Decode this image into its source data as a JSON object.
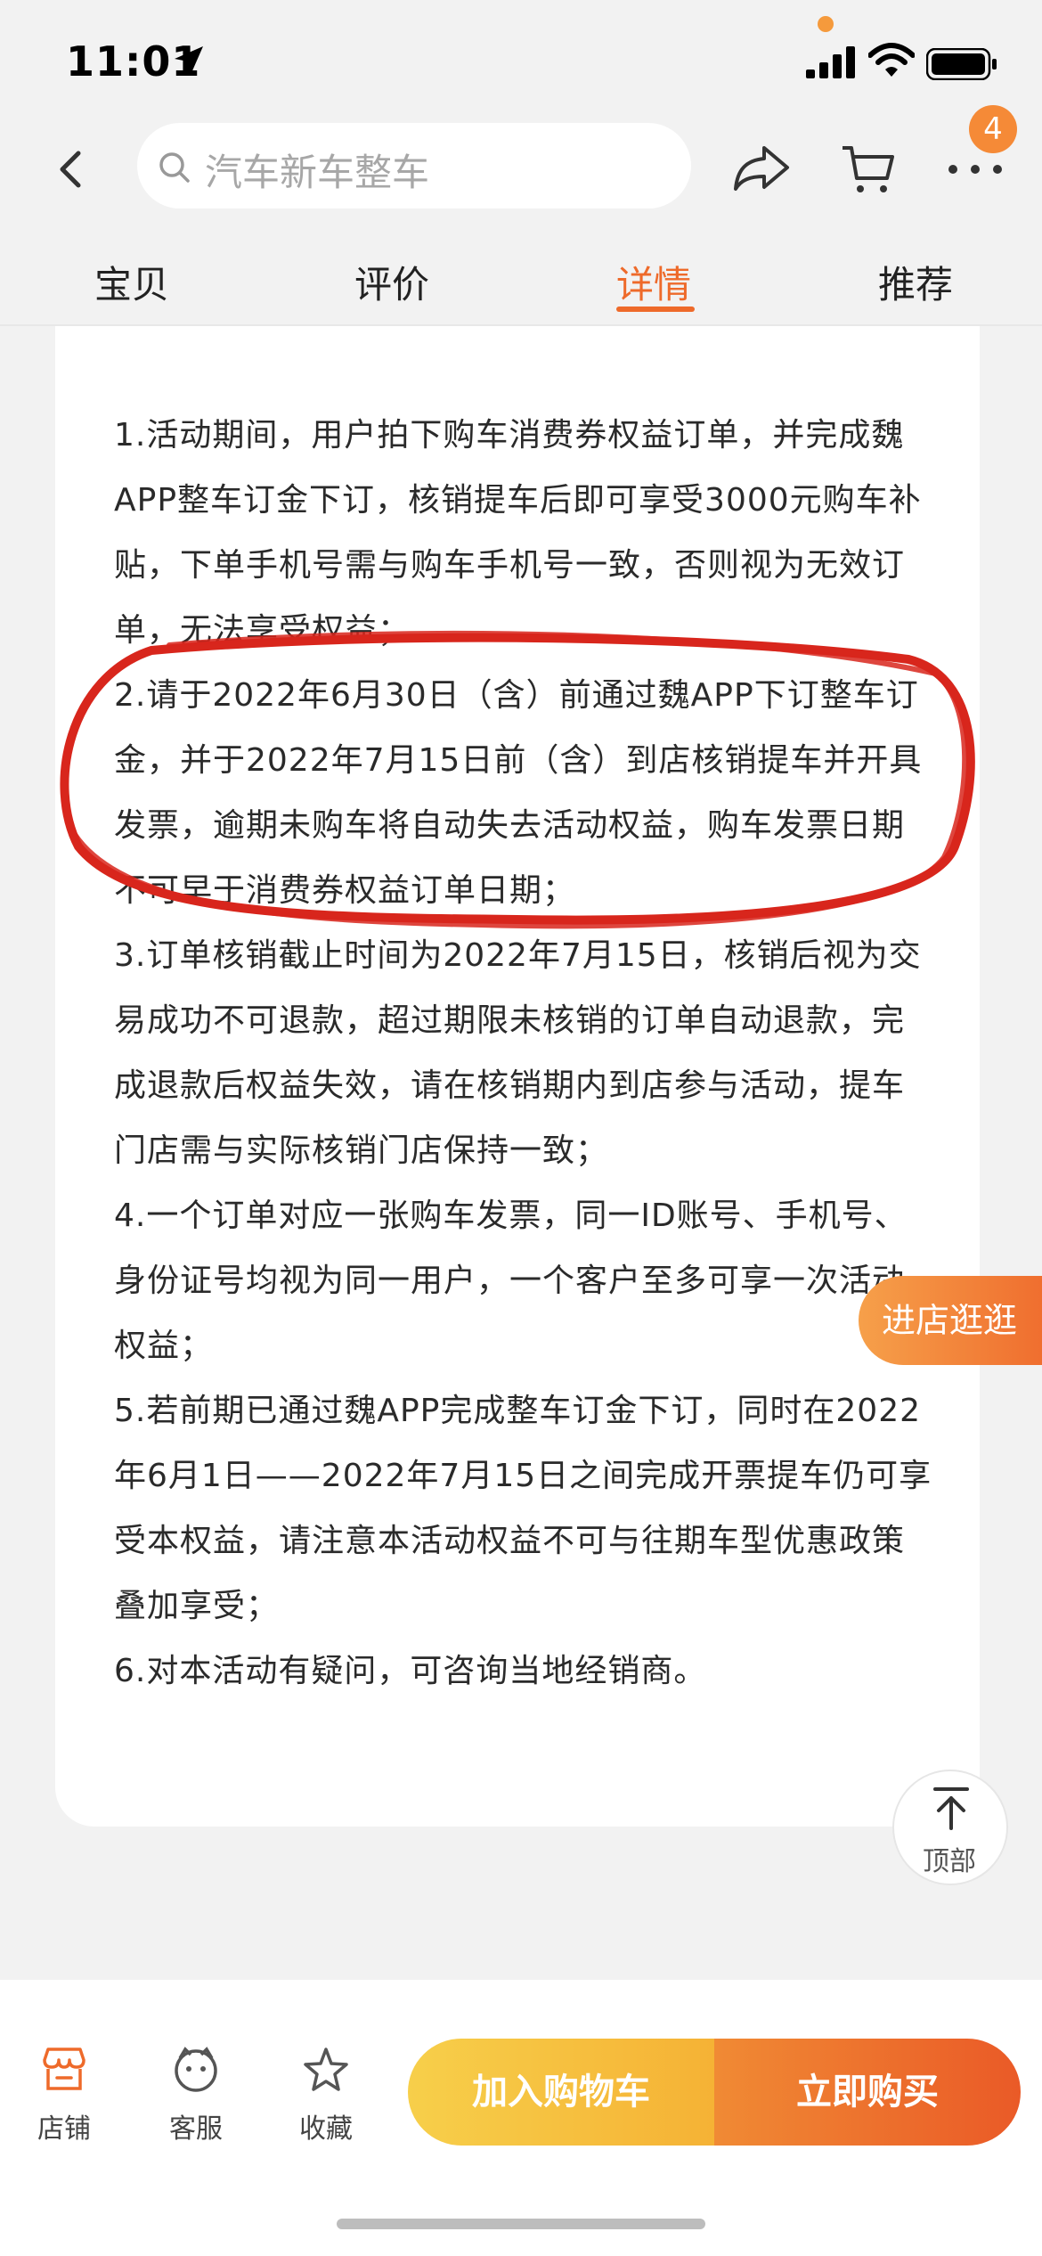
{
  "status": {
    "time": "11:01"
  },
  "search": {
    "placeholder": "汽车新车整车"
  },
  "header": {
    "cart_badge": "4"
  },
  "tabs": [
    {
      "label": "宝贝"
    },
    {
      "label": "评价"
    },
    {
      "label": "详情",
      "active": true
    },
    {
      "label": "推荐"
    }
  ],
  "terms": [
    "1.活动期间，用户拍下购车消费券权益订单，并完成魏APP整车订金下订，核销提车后即可享受3000元购车补贴，下单手机号需与购车手机号一致，否则视为无效订单，无法享受权益；",
    "2.请于2022年6月30日（含）前通过魏APP下订整车订金，并于2022年7月15日前（含）到店核销提车并开具发票，逾期未购车将自动失去活动权益，购车发票日期不可早于消费券权益订单日期；",
    "3.订单核销截止时间为2022年7月15日，核销后视为交易成功不可退款，超过期限未核销的订单自动退款，完成退款后权益失效，请在核销期内到店参与活动，提车门店需与实际核销门店保持一致；",
    "4.一个订单对应一张购车发票，同一ID账号、手机号、身份证号均视为同一用户，一个客户至多可享一次活动权益；",
    "5.若前期已通过魏APP完成整车订金下订，同时在2022年6月1日——2022年7月15日之间完成开票提车仍可享受本权益，请注意本活动权益不可与往期车型优惠政策叠加享受；",
    "6.对本活动有疑问，可咨询当地经销商。"
  ],
  "floating": {
    "store": "进店逛逛",
    "top": "顶部"
  },
  "bottom_nav": [
    {
      "label": "店铺",
      "icon": "store-icon"
    },
    {
      "label": "客服",
      "icon": "service-icon"
    },
    {
      "label": "收藏",
      "icon": "star-icon"
    }
  ],
  "actions": {
    "add_cart": "加入购物车",
    "buy_now": "立即购买"
  },
  "colors": {
    "accent": "#ee6a2a",
    "annotation": "#d8261c"
  }
}
